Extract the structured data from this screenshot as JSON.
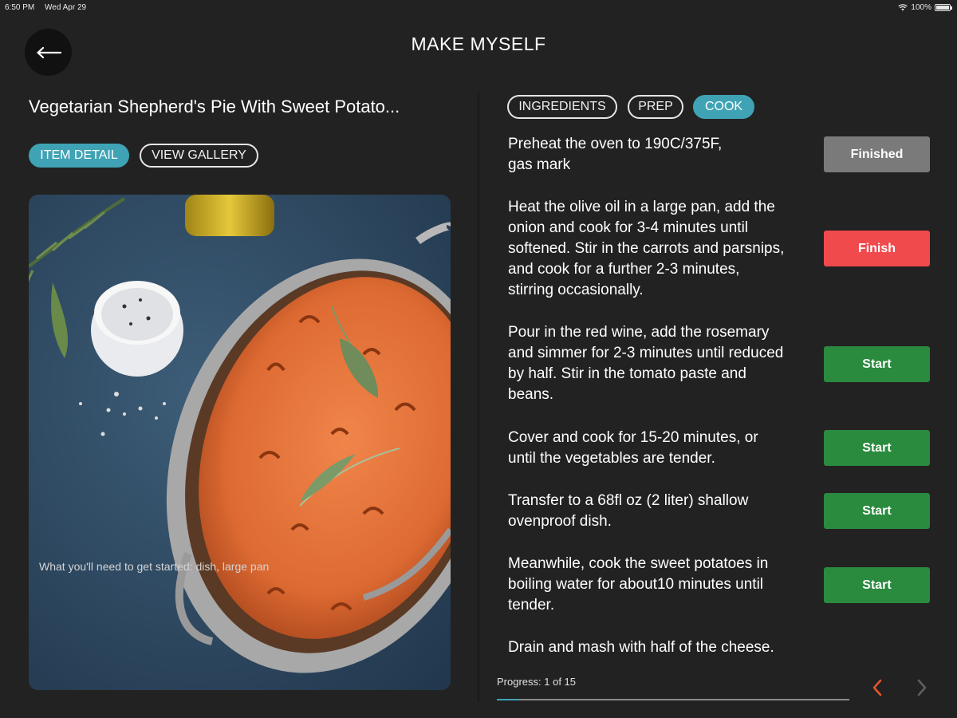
{
  "status_bar": {
    "time": "6:50 PM",
    "date": "Wed Apr 29",
    "battery": "100%"
  },
  "header": {
    "title": "MAKE MYSELF",
    "back_icon": "back-arrow-icon"
  },
  "recipe": {
    "title": "Vegetarian Shepherd's Pie With Sweet Potato...",
    "tabs": [
      {
        "label": "ITEM DETAIL",
        "active": true
      },
      {
        "label": "VIEW GALLERY",
        "active": false
      }
    ],
    "needs_caption": "What you'll need to get started: dish, large pan"
  },
  "section_tabs": [
    {
      "label": "INGREDIENTS",
      "active": false
    },
    {
      "label": "PREP",
      "active": false
    },
    {
      "label": "COOK",
      "active": true
    }
  ],
  "steps": [
    {
      "lines": [
        "Preheat the oven to 190C/375F,",
        "gas mark"
      ],
      "button": "Finished",
      "status": "finished"
    },
    {
      "lines": [
        "Heat the olive oil in a large pan, add the",
        "onion and cook for 3-4 minutes until",
        "softened. Stir in the carrots and parsnips,",
        "and cook for a further 2-3 minutes,",
        "stirring occasionally."
      ],
      "button": "Finish",
      "status": "in-progress"
    },
    {
      "lines": [
        "Pour in the red wine, add the rosemary",
        "and simmer for 2-3 minutes until reduced",
        "by half. Stir in the tomato paste and",
        "beans."
      ],
      "button": "Start",
      "status": "pending"
    },
    {
      "lines": [
        "Cover and cook for 15-20 minutes, or",
        "until the vegetables are tender."
      ],
      "button": "Start",
      "status": "pending"
    },
    {
      "lines": [
        "Transfer to a 68fl oz (2 liter) shallow",
        "ovenproof dish."
      ],
      "button": "Start",
      "status": "pending"
    },
    {
      "lines": [
        "Meanwhile, cook the sweet potatoes in",
        "boiling water for about10 minutes until",
        "tender."
      ],
      "button": "Start",
      "status": "pending"
    },
    {
      "lines": [
        "Drain and mash with half of the cheese."
      ],
      "button": null,
      "status": "pending"
    }
  ],
  "progress": {
    "label": "Progress: 1 of 15",
    "current": 1,
    "total": 15
  },
  "pager": {
    "prev_icon": "chevron-left-icon",
    "next_icon": "chevron-right-icon"
  },
  "colors": {
    "background": "#222222",
    "accent": "#3fa3b5",
    "finished": "#7a7a7a",
    "finish": "#f04a4d",
    "start": "#2a8a3e",
    "prev_arrow": "#e2542c",
    "next_arrow_disabled": "#5e5e5e"
  }
}
